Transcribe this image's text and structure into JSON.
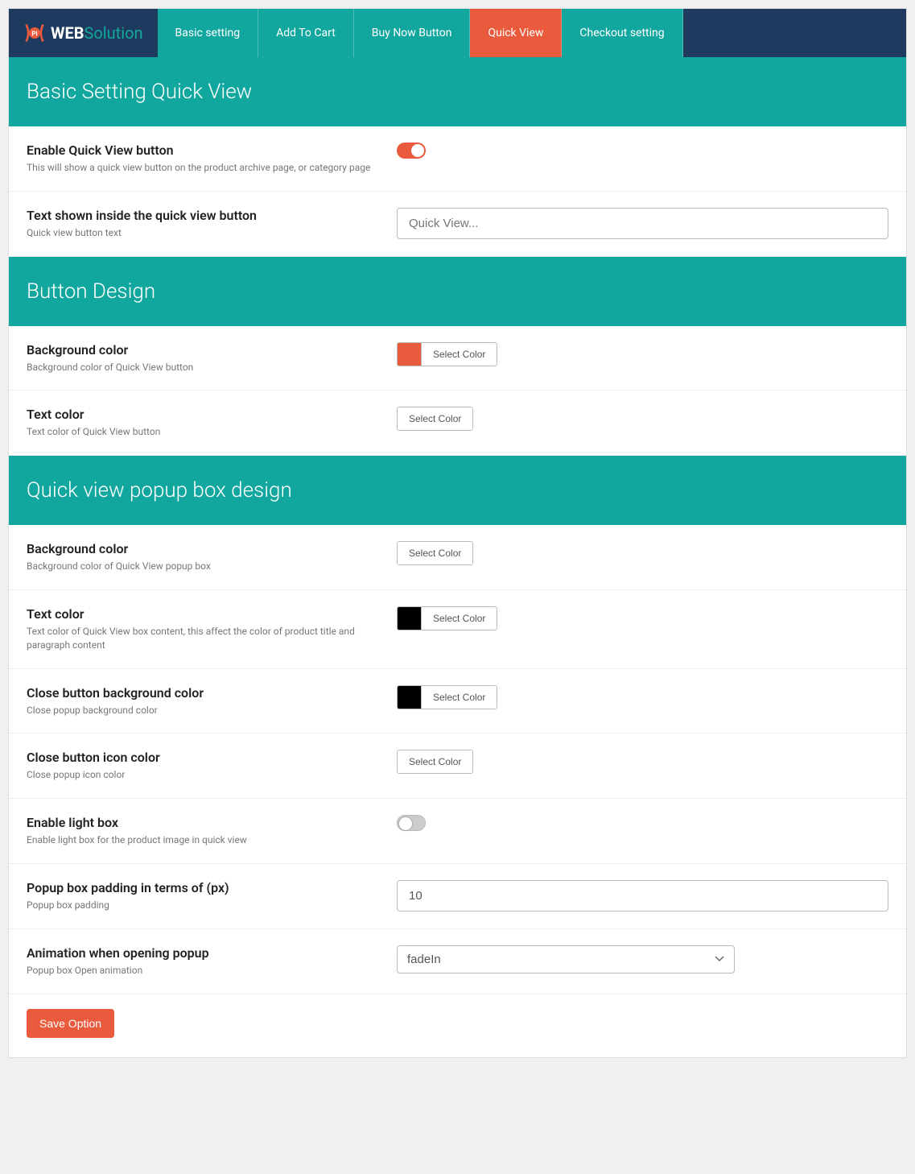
{
  "brand": {
    "web": "WEB",
    "solution": "Solution"
  },
  "tabs": [
    {
      "label": "Basic setting"
    },
    {
      "label": "Add To Cart"
    },
    {
      "label": "Buy Now Button"
    },
    {
      "label": "Quick View",
      "active": true
    },
    {
      "label": "Checkout setting"
    }
  ],
  "sections": {
    "basic": {
      "title": "Basic Setting Quick View",
      "rows": {
        "enable": {
          "label": "Enable Quick View button",
          "desc": "This will show a quick view button on the product archive page, or category page",
          "on": true
        },
        "text": {
          "label": "Text shown inside the quick view button",
          "desc": "Quick view button text",
          "placeholder": "Quick View..."
        }
      }
    },
    "button": {
      "title": "Button Design",
      "rows": {
        "bg": {
          "label": "Background color",
          "desc": "Background color of Quick View button",
          "swatch": "#ea5a3d",
          "btn": "Select Color"
        },
        "text": {
          "label": "Text color",
          "desc": "Text color of Quick View button",
          "btn": "Select Color"
        }
      }
    },
    "popup": {
      "title": "Quick view popup box design",
      "rows": {
        "bg": {
          "label": "Background color",
          "desc": "Background color of Quick View popup box",
          "btn": "Select Color"
        },
        "text": {
          "label": "Text color",
          "desc": "Text color of Quick View box content, this affect the color of product title and paragraph content",
          "swatch": "#000000",
          "btn": "Select Color"
        },
        "closebg": {
          "label": "Close button background color",
          "desc": "Close popup background color",
          "swatch": "#000000",
          "btn": "Select Color"
        },
        "closeicon": {
          "label": "Close button icon color",
          "desc": "Close popup icon color",
          "btn": "Select Color"
        },
        "lightbox": {
          "label": "Enable light box",
          "desc": "Enable light box for the product image in quick view",
          "on": false
        },
        "padding": {
          "label": "Popup box padding in terms of (px)",
          "desc": "Popup box padding",
          "value": "10"
        },
        "anim": {
          "label": "Animation when opening popup",
          "desc": "Popup box Open animation",
          "value": "fadeIn"
        }
      }
    }
  },
  "save": "Save Option"
}
